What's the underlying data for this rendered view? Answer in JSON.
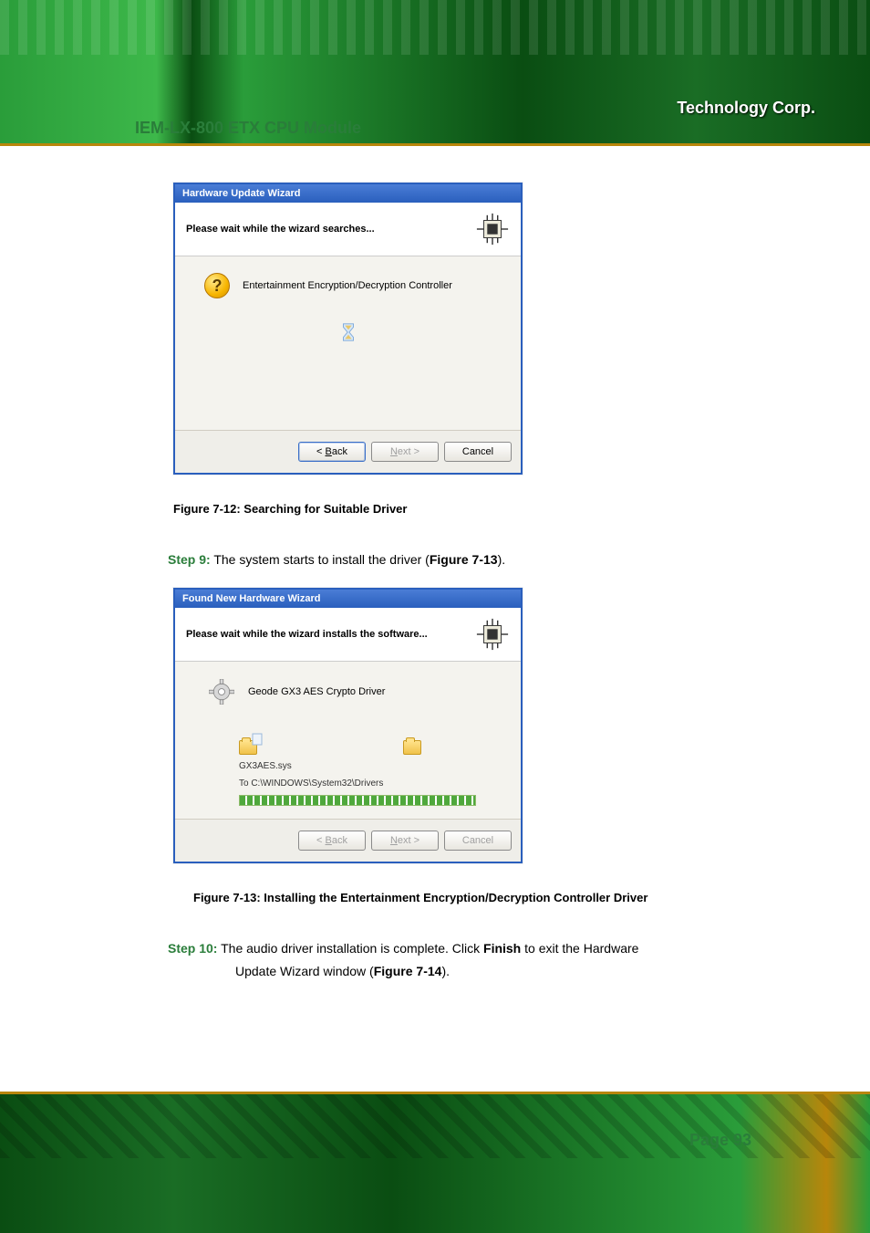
{
  "doc_title": "IEM-LX-800 ETX CPU Module",
  "brand_corp": "Technology Corp.",
  "wizard1": {
    "title": "Hardware Update Wizard",
    "heading": "Please wait while the wizard searches...",
    "device": "Entertainment Encryption/Decryption Controller",
    "back": "< Back",
    "next": "Next >",
    "cancel": "Cancel"
  },
  "caption1": "Figure 7-12: Searching for Suitable Driver",
  "step9_label": "Step 9:",
  "step9_text_a": "The system starts to install the driver (",
  "step9_bold": "Figure 7-13",
  "step9_text_b": ").",
  "wizard2": {
    "title": "Found New Hardware Wizard",
    "heading": "Please wait while the wizard installs the software...",
    "device": "Geode GX3 AES Crypto Driver",
    "file": "GX3AES.sys",
    "dest": "To C:\\WINDOWS\\System32\\Drivers",
    "back": "< Back",
    "next": "Next >",
    "cancel": "Cancel"
  },
  "caption2": "Figure 7-13: Installing the Entertainment Encryption/Decryption Controller Driver",
  "step10_label": "Step 10:",
  "step10_text_a": "The audio driver installation is complete. Click ",
  "step10_bold1": "Finish",
  "step10_text_b": " to exit the Hardware",
  "step10_text_c": "Update Wizard window (",
  "step10_bold2": "Figure 7-14",
  "step10_text_d": ").",
  "page_number": "Page 93"
}
